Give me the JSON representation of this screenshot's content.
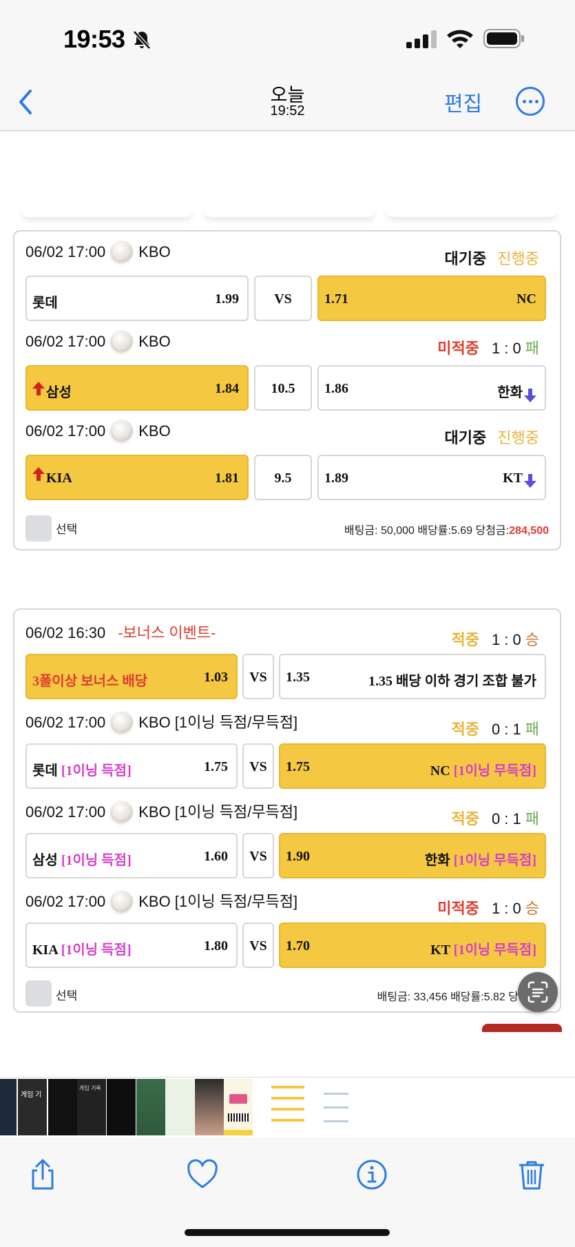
{
  "status_bar": {
    "time": "19:53"
  },
  "nav": {
    "title": "오늘",
    "subtitle": "19:52",
    "edit_label": "편집"
  },
  "slip1": {
    "games": [
      {
        "datetime": "06/02 17:00",
        "league": "KBO",
        "status": "대기중",
        "status2": "진행중",
        "home": "롯데",
        "home_odds": "1.99",
        "mid": "VS",
        "away_odds": "1.71",
        "away": "NC"
      },
      {
        "datetime": "06/02 17:00",
        "league": "KBO",
        "status": "미적중",
        "score": "1 : 0",
        "result": "패",
        "home": "삼성",
        "home_odds": "1.84",
        "mid": "10.5",
        "away_odds": "1.86",
        "away": "한화"
      },
      {
        "datetime": "06/02 17:00",
        "league": "KBO",
        "status": "대기중",
        "status2": "진행중",
        "home": "KIA",
        "home_odds": "1.81",
        "mid": "9.5",
        "away_odds": "1.89",
        "away": "KT"
      }
    ],
    "select_label": "선택",
    "bet_label": "배팅금: 50,000 배당률:5.69 당첨금:",
    "bet_win": "284,500"
  },
  "slip2": {
    "games": [
      {
        "datetime": "06/02 16:30",
        "league": "-보너스 이벤트-",
        "status": "적중",
        "score": "1 : 0",
        "result": "승",
        "home": "3폴이상 보너스 배당",
        "home_odds": "1.03",
        "mid": "VS",
        "away_odds": "1.35",
        "away": "1.35 배당 이하 경기 조합 불가"
      },
      {
        "datetime": "06/02 17:00",
        "league": "KBO [1이닝 득점/무득점]",
        "status": "적중",
        "score": "0 : 1",
        "result": "패",
        "home": "롯데",
        "home_tag": "[1이닝 득점]",
        "home_odds": "1.75",
        "mid": "VS",
        "away_odds": "1.75",
        "away": "NC",
        "away_tag": "[1이닝 무득점]"
      },
      {
        "datetime": "06/02 17:00",
        "league": "KBO [1이닝 득점/무득점]",
        "status": "적중",
        "score": "0 : 1",
        "result": "패",
        "home": "삼성",
        "home_tag": "[1이닝 득점]",
        "home_odds": "1.60",
        "mid": "VS",
        "away_odds": "1.90",
        "away": "한화",
        "away_tag": "[1이닝 무득점]"
      },
      {
        "datetime": "06/02 17:00",
        "league": "KBO [1이닝 득점/무득점]",
        "status": "미적중",
        "score": "1 : 0",
        "result": "승",
        "home": "KIA",
        "home_tag": "[1이닝 득점]",
        "home_odds": "1.80",
        "mid": "VS",
        "away_odds": "1.70",
        "away": "KT",
        "away_tag": "[1이닝 무득점]"
      }
    ],
    "select_label": "선택",
    "bet_label": "배팅금: 33,456 배당률:5.82 당"
  },
  "thumbnails": {
    "t1_text": "게임 기",
    "t3_text": "게임 기록"
  },
  "colors": {
    "accent_blue": "#2c7be5",
    "selected_yellow": "#f5c842",
    "loss_red": "#e03a2f",
    "pending_gold": "#e8b43a"
  }
}
